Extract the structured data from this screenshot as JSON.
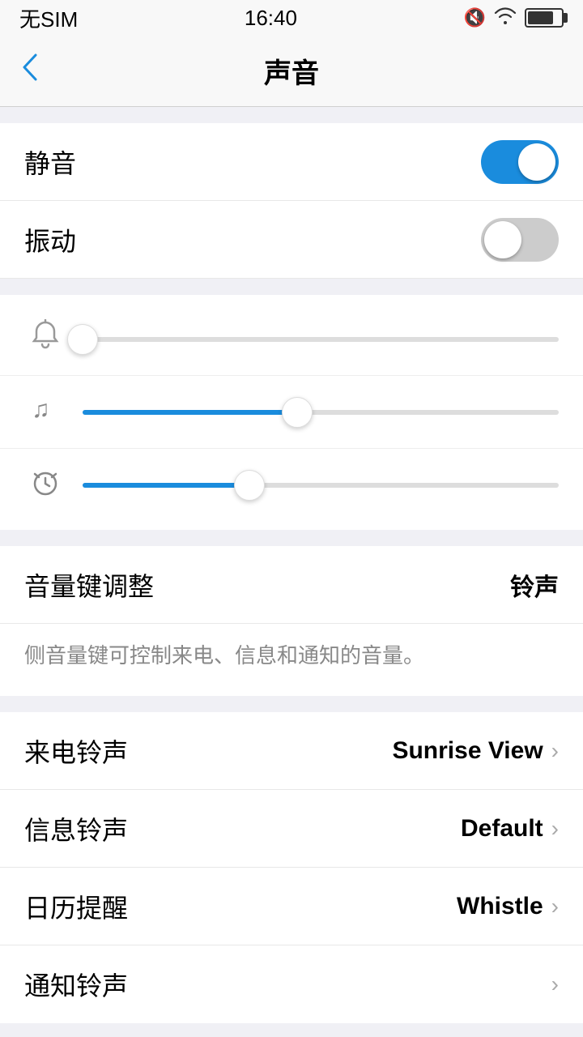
{
  "statusBar": {
    "carrier": "无SIM",
    "time": "16:40",
    "icons": {
      "muted": "🔇",
      "wifi": "wifi",
      "battery": "battery"
    }
  },
  "navBar": {
    "backLabel": "<",
    "title": "声音"
  },
  "toggles": [
    {
      "id": "mute",
      "label": "静音",
      "state": "on"
    },
    {
      "id": "vibrate",
      "label": "振动",
      "state": "off"
    }
  ],
  "sliders": [
    {
      "id": "ringtone-vol",
      "icon": "🔔",
      "fillPercent": 0,
      "isBlue": false
    },
    {
      "id": "media-vol",
      "icon": "🎵",
      "fillPercent": 45,
      "isBlue": true
    },
    {
      "id": "alarm-vol",
      "icon": "⏰",
      "fillPercent": 35,
      "isBlue": true
    }
  ],
  "volumeKey": {
    "label": "音量键调整",
    "value": "铃声",
    "description": "侧音量键可控制来电、信息和通知的音量。"
  },
  "ringtoneSettings": [
    {
      "id": "call-ringtone",
      "label": "来电铃声",
      "value": "Sunrise View"
    },
    {
      "id": "msg-ringtone",
      "label": "信息铃声",
      "value": "Default"
    },
    {
      "id": "calendar-ringtone",
      "label": "日历提醒",
      "value": "Whistle"
    },
    {
      "id": "notify-ringtone",
      "label": "通知铃声",
      "value": ""
    }
  ]
}
